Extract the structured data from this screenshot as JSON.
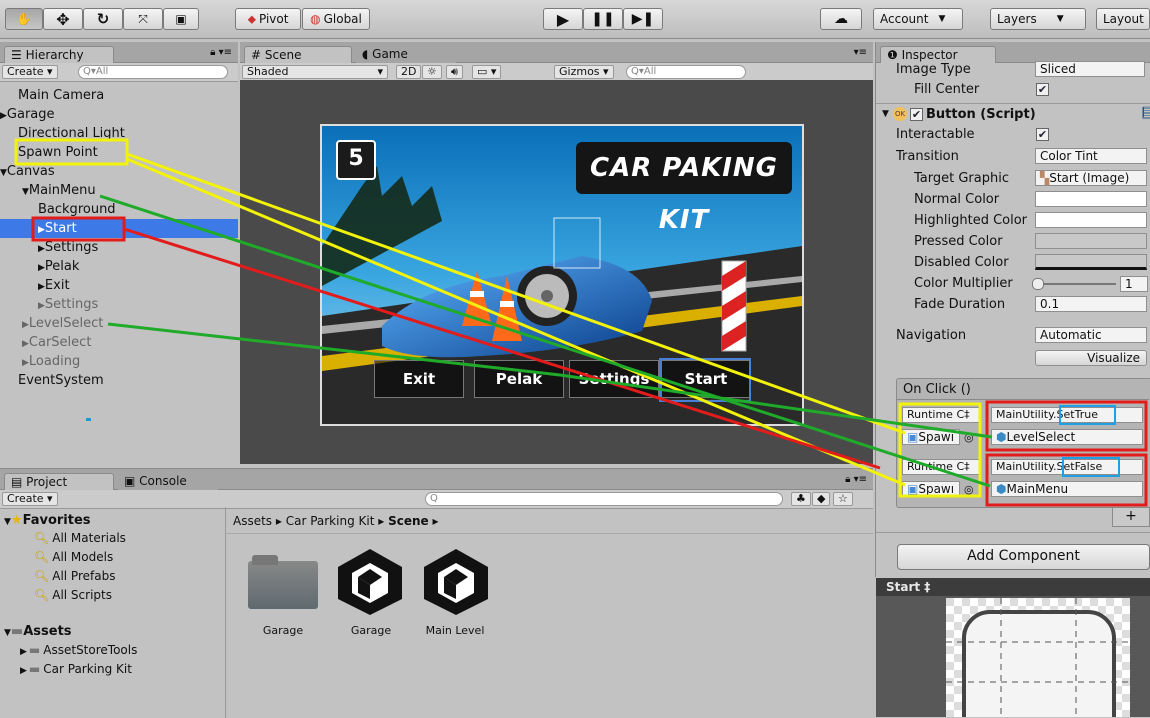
{
  "toolbar": {
    "pivot": "Pivot",
    "global": "Global",
    "account": "Account",
    "layers": "Layers",
    "layout": "Layout"
  },
  "hierarchy": {
    "tab": "Hierarchy",
    "create": "Create",
    "search_placeholder": "All",
    "items": [
      {
        "label": "Main Camera",
        "arrow": ""
      },
      {
        "label": "Garage",
        "arrow": "▶"
      },
      {
        "label": "Directional Light",
        "arrow": ""
      },
      {
        "label": "Spawn Point",
        "arrow": ""
      },
      {
        "label": "Canvas",
        "arrow": "▼"
      },
      {
        "label": "MainMenu",
        "arrow": "▼"
      },
      {
        "label": "Background",
        "arrow": ""
      },
      {
        "label": "Start",
        "arrow": "▶"
      },
      {
        "label": "Settings",
        "arrow": "▶"
      },
      {
        "label": "Pelak",
        "arrow": "▶"
      },
      {
        "label": "Exit",
        "arrow": "▶"
      },
      {
        "label": "Settings",
        "arrow": "▶"
      },
      {
        "label": "LevelSelect",
        "arrow": "▶"
      },
      {
        "label": "CarSelect",
        "arrow": "▶"
      },
      {
        "label": "Loading",
        "arrow": "▶"
      },
      {
        "label": "EventSystem",
        "arrow": ""
      }
    ]
  },
  "scene": {
    "tab_scene": "Scene",
    "tab_game": "Game",
    "shaded": "Shaded",
    "mode_2d": "2D",
    "gizmos": "Gizmos",
    "search_placeholder": "All",
    "badge": "5",
    "logo_text": "CAR PAKING KIT",
    "menu_buttons": [
      "Exit",
      "Pelak",
      "Settings",
      "Start"
    ]
  },
  "inspector": {
    "tab": "Inspector",
    "image_type_label": "Image Type",
    "image_type_value": "Sliced",
    "fill_center_label": "Fill Center",
    "component_title": "Button (Script)",
    "interactable_label": "Interactable",
    "transition_label": "Transition",
    "transition_value": "Color Tint",
    "target_graphic_label": "Target Graphic",
    "target_graphic_value": "Start (Image)",
    "normal_color_label": "Normal Color",
    "highlighted_color_label": "Highlighted Color",
    "pressed_color_label": "Pressed Color",
    "disabled_color_label": "Disabled Color",
    "color_multiplier_label": "Color Multiplier",
    "color_multiplier_value": "1",
    "fade_duration_label": "Fade Duration",
    "fade_duration_value": "0.1",
    "navigation_label": "Navigation",
    "navigation_value": "Automatic",
    "visualize": "Visualize",
    "onclick_header": "On Click ()",
    "events": [
      {
        "runtime": "Runtime C‡",
        "func_prefix": "MainUtility.",
        "func_method": "SetTrue",
        "target": "Spawı",
        "object": "LevelSelect"
      },
      {
        "runtime": "Runtime C‡",
        "func_prefix": "MainUtility.",
        "func_method": "SetFalse",
        "target": "Spawı",
        "object": "MainMenu"
      }
    ],
    "plus": "+",
    "add_component": "Add Component",
    "preview_title": "Start ‡"
  },
  "project": {
    "tab_project": "Project",
    "tab_console": "Console",
    "create": "Create",
    "favorites_label": "Favorites",
    "favorites": [
      "All Materials",
      "All Models",
      "All Prefabs",
      "All Scripts"
    ],
    "assets_label": "Assets",
    "assets": [
      "AssetStoreTools",
      "Car Parking Kit"
    ],
    "breadcrumb": [
      "Assets",
      "Car Parking Kit",
      "Scene"
    ],
    "files": [
      "Garage",
      "Garage",
      "Main Level"
    ]
  },
  "colors": {
    "selection": "#3d7ae8",
    "highlight_yellow": "#f2f20a",
    "highlight_red": "#e21b1b",
    "highlight_green": "#1faa2a",
    "highlight_blue": "#1fa0e6"
  }
}
